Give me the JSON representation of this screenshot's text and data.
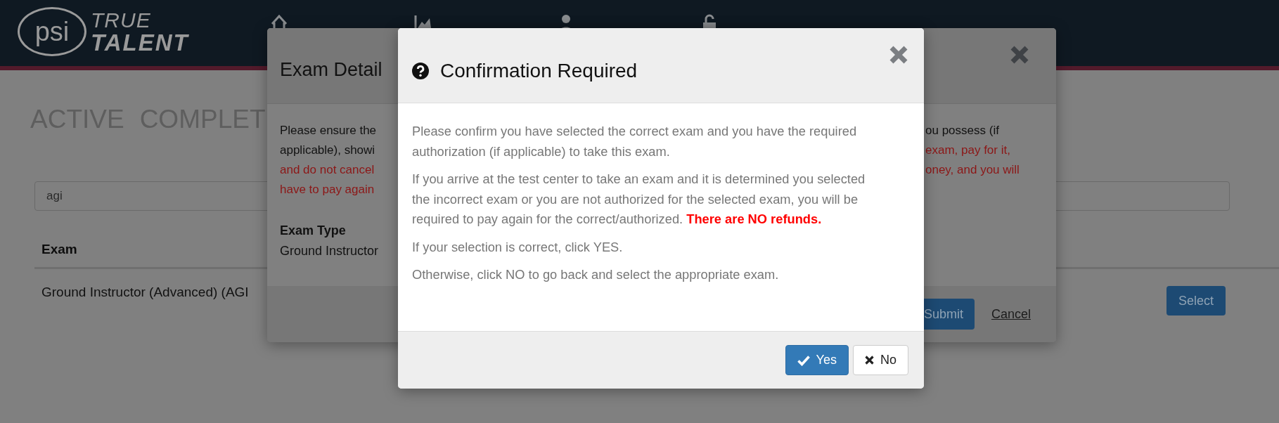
{
  "header": {
    "logo": {
      "mark": "psi",
      "line1": "TRUE",
      "line2": "TALENT"
    },
    "nav_icons": [
      {
        "kind": "house"
      },
      {
        "kind": "chart"
      },
      {
        "kind": "person"
      },
      {
        "kind": "lock"
      }
    ]
  },
  "tabs": [
    {
      "label": "ACTIVE",
      "selected": false
    },
    {
      "label": "COMPLET",
      "selected": false
    }
  ],
  "search": {
    "value": "agi"
  },
  "table": {
    "columns": [
      "Exam"
    ],
    "rows": [
      {
        "cells": [
          "Ground Instructor (Advanced) (AGI"
        ],
        "action": "Select"
      }
    ]
  },
  "exam_details": {
    "title": "Exam Detail",
    "body_left": [
      {
        "text": "Please ensure the",
        "alert": false
      },
      {
        "text": "applicable), showi",
        "alert": false
      },
      {
        "text": "and do not cancel",
        "alert": true
      },
      {
        "text": "have to pay again",
        "alert": true
      }
    ],
    "body_right": [
      {
        "text": "ou possess (if",
        "alert": false
      },
      {
        "text": "exam, pay for it,",
        "alert": true
      },
      {
        "text": "oney, and you will",
        "alert": true
      }
    ],
    "exam_type_label": "Exam Type",
    "exam_type_value": "Ground Instructor",
    "submit": "Submit",
    "cancel": "Cancel"
  },
  "confirm": {
    "title": "Confirmation Required",
    "paragraphs": [
      "Please confirm you have selected the correct exam and you have the required authorization (if applicable) to take this exam.",
      "If you arrive at the test center to take an exam and it is determined you selected the incorrect exam or you are not authorized for the selected exam, you will be required to pay again for the correct/authorized. **There are NO refunds.**",
      "If your selection is correct, click YES.",
      "Otherwise, click NO to go back and select the appropriate exam."
    ],
    "buttons": [
      {
        "label": "Yes",
        "kind": "primary"
      },
      {
        "label": "No",
        "kind": "default"
      }
    ]
  }
}
